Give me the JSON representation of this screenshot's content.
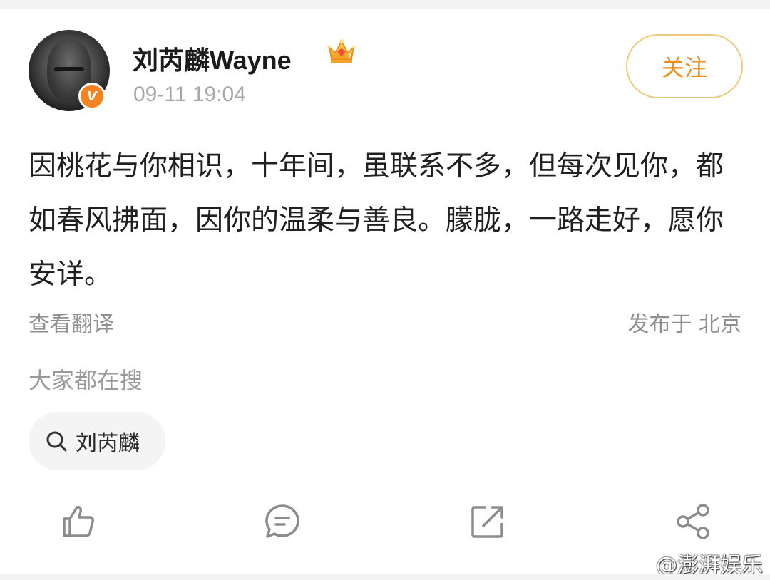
{
  "post": {
    "author": "刘芮麟Wayne",
    "timestamp": "09-11 19:04",
    "follow_label": "关注",
    "text": "因桃花与你相识，十年间，虽联系不多，但每次见你，都如春风拂面，因你的温柔与善良。朦胧，一路走好，愿你安详。",
    "translate_label": "查看翻译",
    "location": "发布于 北京"
  },
  "search": {
    "title": "大家都在搜",
    "chip_label": "刘芮麟"
  },
  "badges": {
    "verified": "V",
    "crown_level": "7"
  },
  "actions": {
    "icons": [
      "like-icon",
      "comment-icon",
      "repost-icon",
      "share-icon"
    ]
  },
  "watermark": {
    "text": "@澎湃娱乐"
  },
  "colors": {
    "accent": "#f08e1c",
    "follow_border": "#f3c87e",
    "verified_badge": "#f5821f"
  }
}
